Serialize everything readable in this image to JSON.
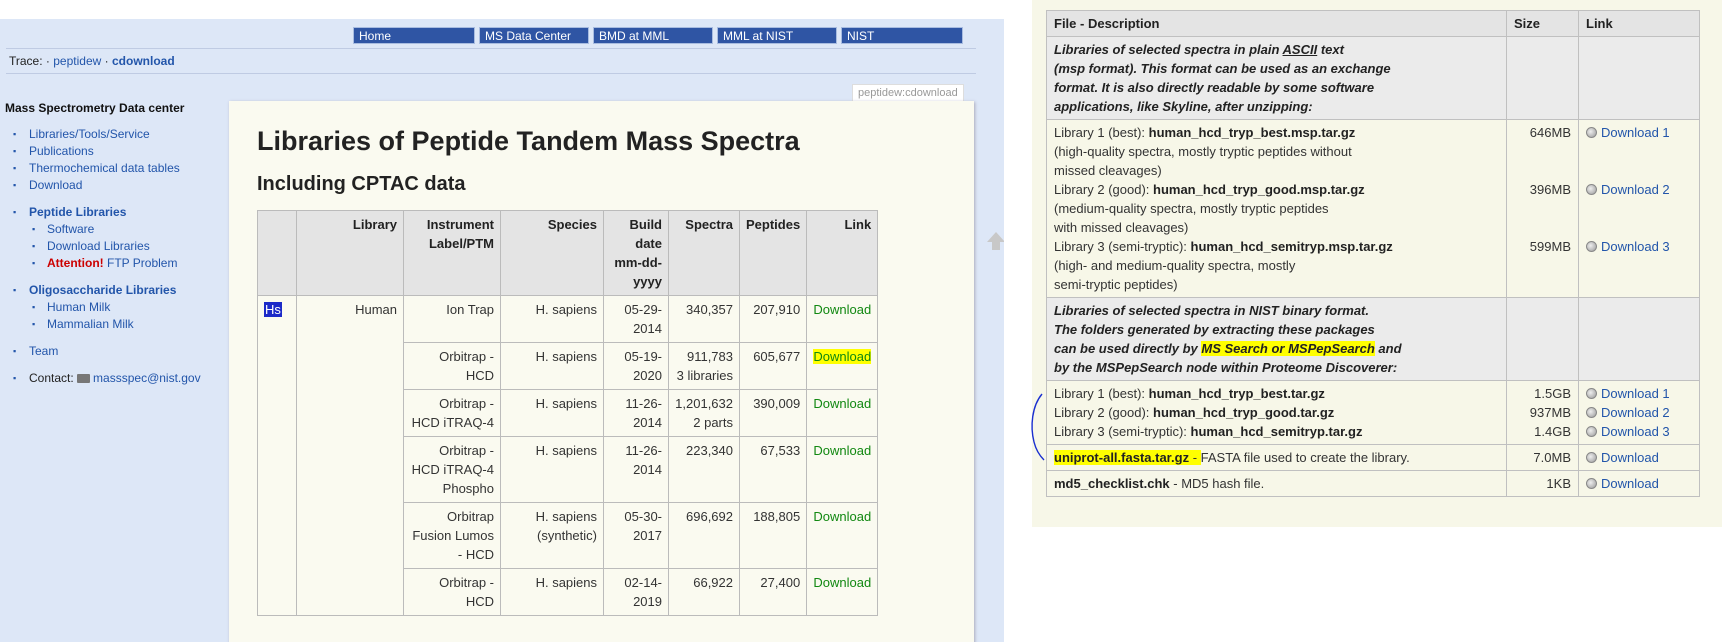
{
  "nav": {
    "items": [
      "Home",
      "MS Data Center",
      "BMD at MML",
      "MML at NIST",
      "NIST"
    ]
  },
  "trace": {
    "label": "Trace:",
    "sep": "·",
    "items": [
      "peptidew",
      "cdownload"
    ]
  },
  "sidebar": {
    "title": "Mass Spectrometry Data center",
    "items": [
      "Libraries/Tools/Service",
      "Publications",
      "Thermochemical data tables",
      "Download"
    ],
    "peptide_group": "Peptide Libraries",
    "peptide_items": [
      "Software",
      "Download Libraries"
    ],
    "attention": "Attention!",
    "ftp_problem": "FTP Problem",
    "oligo_group": "Oligosaccharide Libraries",
    "oligo_items": [
      "Human Milk",
      "Mammalian Milk"
    ],
    "team": "Team",
    "contact_label": "Contact:",
    "contact_email": "massspec@nist.gov"
  },
  "tab_label": "peptidew:cdownload",
  "page": {
    "title": "Libraries of Peptide Tandem Mass Spectra",
    "subtitle": "Including CPTAC data"
  },
  "library_table": {
    "headers": [
      "",
      "Library",
      "Instrument Label/PTM",
      "Species",
      "Build date mm-dd-yyyy",
      "Spectra",
      "Peptides",
      "Link"
    ],
    "abbr": "Hs",
    "library": "Human",
    "rows": [
      {
        "instrument": "Ion Trap",
        "species": "H. sapiens",
        "date": "05-29-2014",
        "spectra": "340,357",
        "spectra_note": "",
        "peptides": "207,910",
        "link": "Download"
      },
      {
        "instrument": "Orbitrap - HCD",
        "species": "H. sapiens",
        "date": "05-19-2020",
        "spectra": "911,783",
        "spectra_note": "3 libraries",
        "peptides": "605,677",
        "link": "Download"
      },
      {
        "instrument": "Orbitrap - HCD iTRAQ-4",
        "species": "H. sapiens",
        "date": "11-26-2014",
        "spectra": "1,201,632",
        "spectra_note": "2 parts",
        "peptides": "390,009",
        "link": "Download"
      },
      {
        "instrument": "Orbitrap - HCD iTRAQ-4 Phospho",
        "species": "H. sapiens",
        "date": "11-26-2014",
        "spectra": "223,340",
        "spectra_note": "",
        "peptides": "67,533",
        "link": "Download"
      },
      {
        "instrument": "Orbitrap Fusion Lumos - HCD",
        "species": "H. sapiens (synthetic)",
        "date": "05-30-2017",
        "spectra": "696,692",
        "spectra_note": "",
        "peptides": "188,805",
        "link": "Download"
      },
      {
        "instrument": "Orbitrap - HCD",
        "species": "H. sapiens",
        "date": "02-14-2019",
        "spectra": "66,922",
        "spectra_note": "",
        "peptides": "27,400",
        "link": "Download"
      }
    ]
  },
  "files_table": {
    "headers": [
      "File - Description",
      "Size",
      "Link"
    ],
    "msp_section": {
      "line1": "Libraries of selected spectra in plain ",
      "ascii": "ASCII",
      "line1b": " text",
      "line2": "(msp format). This format can be used as an exchange",
      "line3": "format. It is also directly readable by some software",
      "line4": "applications, like Skyline, after unzipping:"
    },
    "msp_files": [
      {
        "prefix": "Library 1 (best): ",
        "file": "human_hcd_tryp_best.msp.tar.gz",
        "desc1": "(high-quality spectra, mostly tryptic peptides without",
        "desc2": "missed cleavages)",
        "size": "646MB",
        "link": "Download 1"
      },
      {
        "prefix": "Library 2 (good): ",
        "file": "human_hcd_tryp_good.msp.tar.gz",
        "desc1": "(medium-quality spectra, mostly tryptic peptides",
        "desc2": "with missed cleavages)",
        "size": "396MB",
        "link": "Download 2"
      },
      {
        "prefix": "Library 3 (semi-tryptic): ",
        "file": "human_hcd_semitryp.msp.tar.gz",
        "desc1": "(high- and medium-quality spectra, mostly",
        "desc2": "semi-tryptic peptides)",
        "size": "599MB",
        "link": "Download 3"
      }
    ],
    "bin_section": {
      "line1": "Libraries of selected spectra in NIST binary format.",
      "line2": "The folders generated by extracting these packages",
      "line3a": "can be used directly by ",
      "line3hl": "MS Search or MSPepSearch",
      "line3b": " and",
      "line4": "by the MSPepSearch node within Proteome Discoverer:"
    },
    "bin_files": [
      {
        "prefix": "Library 1 (best): ",
        "file": "human_hcd_tryp_best.tar.gz",
        "size": "1.5GB",
        "link": "Download 1"
      },
      {
        "prefix": "Library 2 (good): ",
        "file": "human_hcd_tryp_good.tar.gz",
        "size": "937MB",
        "link": "Download 2"
      },
      {
        "prefix": "Library 3 (semi-tryptic): ",
        "file": "human_hcd_semitryp.tar.gz",
        "size": "1.4GB",
        "link": "Download 3"
      }
    ],
    "fasta": {
      "file": "uniprot-all.fasta.tar.gz",
      "dash": " - ",
      "desc": "FASTA file used to create the library.",
      "size": "7.0MB",
      "link": "Download"
    },
    "md5": {
      "file": "md5_checklist.chk",
      "dash": " - ",
      "desc": "MD5 hash file.",
      "size": "1KB",
      "link": "Download"
    }
  },
  "colors": {
    "nav_bg": "#2f55a4",
    "link_blue": "#2255aa",
    "download_green": "#118811",
    "highlight": "#ffff00",
    "pane_bg": "#dde7f7",
    "attention_red": "#cc0000"
  }
}
